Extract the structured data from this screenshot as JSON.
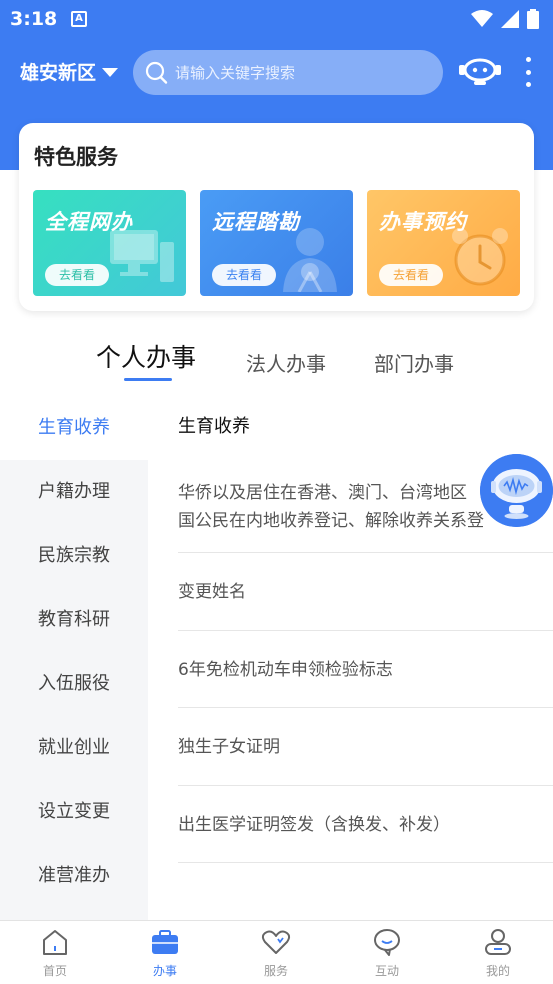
{
  "status_bar": {
    "time": "3:18",
    "a_badge": "A"
  },
  "header": {
    "region": "雄安新区",
    "search_placeholder": "请输入关键字搜索",
    "accent_color": "#3d7cf2"
  },
  "featured": {
    "title": "特色服务",
    "tiles": [
      {
        "title": "全程网办",
        "button": "去看看",
        "icon": "computer-icon"
      },
      {
        "title": "远程踏勘",
        "button": "去看看",
        "icon": "inspector-icon"
      },
      {
        "title": "办事预约",
        "button": "去看看",
        "icon": "alarm-clock-icon"
      }
    ]
  },
  "tabs": [
    {
      "label": "个人办事",
      "active": true
    },
    {
      "label": "法人办事",
      "active": false
    },
    {
      "label": "部门办事",
      "active": false
    }
  ],
  "sidebar": {
    "items": [
      "生育收养",
      "户籍办理",
      "民族宗教",
      "教育科研",
      "入伍服役",
      "就业创业",
      "设立变更",
      "准营准办"
    ],
    "active_index": 0
  },
  "list": {
    "heading": "生育收养",
    "items": [
      {
        "line1": "华侨以及居住在香港、澳门、台湾地区",
        "line2": "国公民在内地收养登记、解除收养关系登"
      },
      {
        "line1": "变更姓名"
      },
      {
        "line1": "6年免检机动车申领检验标志"
      },
      {
        "line1": "独生子女证明"
      },
      {
        "line1": "出生医学证明签发（含换发、补发）"
      }
    ]
  },
  "bottom_nav": [
    {
      "label": "首页",
      "icon": "home-icon",
      "active": false
    },
    {
      "label": "办事",
      "icon": "briefcase-icon",
      "active": true
    },
    {
      "label": "服务",
      "icon": "heart-icon",
      "active": false
    },
    {
      "label": "互动",
      "icon": "chat-bubble-icon",
      "active": false
    },
    {
      "label": "我的",
      "icon": "user-icon",
      "active": false
    }
  ]
}
